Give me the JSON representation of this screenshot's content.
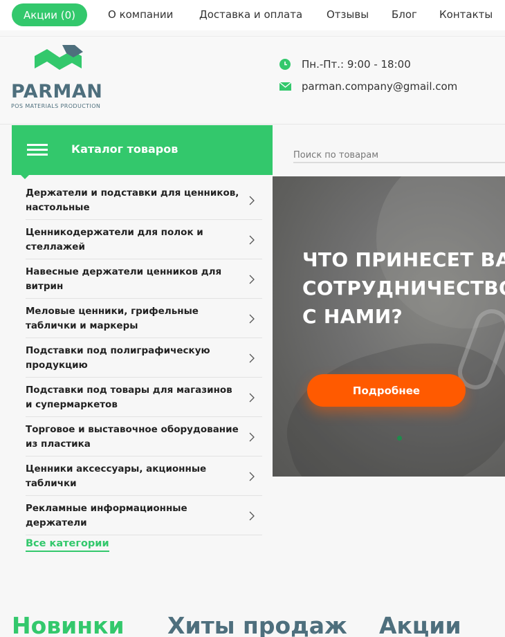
{
  "topnav": {
    "promo_label": "Акции (0)",
    "links": [
      "О компании",
      "Доставка и оплата",
      "Отзывы",
      "Блог",
      "Контакты"
    ]
  },
  "header": {
    "logo_text": "PARMAN",
    "logo_subtitle": "POS MATERIALS PRODUCTION",
    "hours": "Пн.-Пт.: 9:00 - 18:00",
    "email": "parman.company@gmail.com",
    "icons": [
      "clock-icon",
      "mail-icon"
    ]
  },
  "catalog": {
    "title": "Каталог товаров",
    "items": [
      "Держатели и подставки для ценников, настольные",
      "Ценникодержатели для полок и стеллажей",
      "Навесные держатели ценников для витрин",
      "Меловые ценники, грифельные таблички и маркеры",
      "Подставки под полиграфическую продукцию",
      "Подставки под товары для магазинов и супермаркетов",
      "Торговое и выставочное оборудование из пластика",
      "Ценники аксессуары, акционные таблички",
      "Рекламные информационные держатели"
    ],
    "all_label": "Все категории"
  },
  "search": {
    "placeholder": "Поиск по товарам"
  },
  "banner": {
    "title_lines": [
      "ЧТО ПРИНЕСЕТ ВАМ",
      "СОТРУДНИЧЕСТВО",
      "С НАМИ?"
    ],
    "button_label": "Подробнее"
  },
  "tabs": [
    "Новинки",
    "Хиты продаж",
    "Акции"
  ],
  "colors": {
    "accent_green": "#33c86c",
    "orange": "#ff5a00",
    "logo_blue": "#4e6f7d",
    "tab_inactive": "#4e6f7d"
  }
}
